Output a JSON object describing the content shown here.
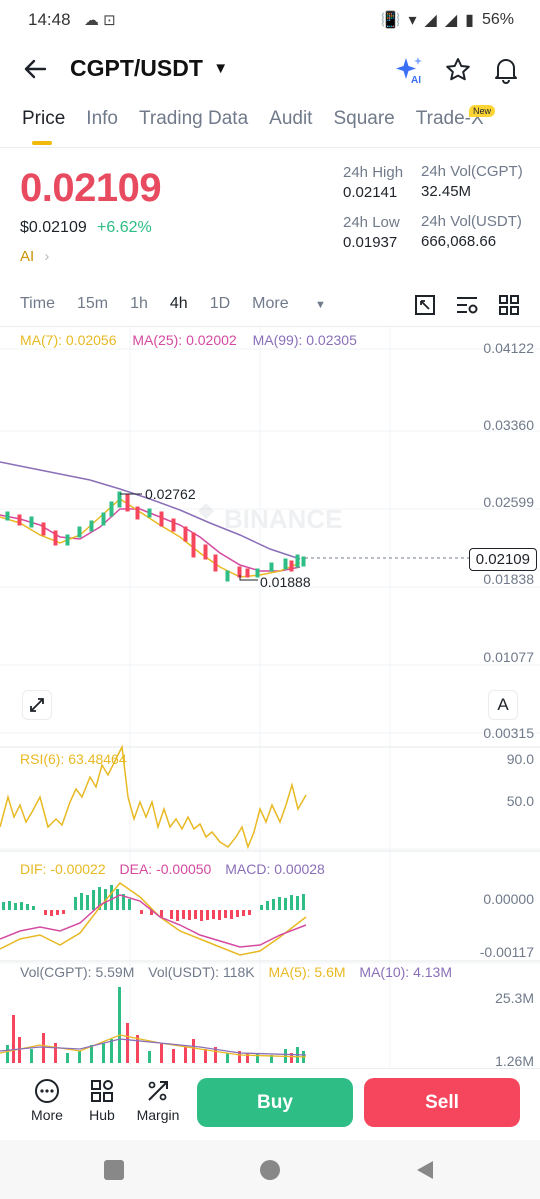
{
  "status_bar": {
    "time": "14:48",
    "battery": "56%"
  },
  "header": {
    "pair": "CGPT/USDT"
  },
  "tabs": [
    {
      "label": "Price"
    },
    {
      "label": "Info"
    },
    {
      "label": "Trading Data"
    },
    {
      "label": "Audit"
    },
    {
      "label": "Square"
    },
    {
      "label": "Trade-X"
    }
  ],
  "new_badge": "New",
  "ticker": {
    "last_price": "0.02109",
    "usd_price": "$0.02109",
    "change": "+6.62%",
    "ai_label": "AI",
    "high_label": "24h High",
    "high_value": "0.02141",
    "low_label": "24h Low",
    "low_value": "0.01937",
    "vol_base_label": "24h Vol(CGPT)",
    "vol_base_value": "32.45M",
    "vol_quote_label": "24h Vol(USDT)",
    "vol_quote_value": "666,068.66"
  },
  "intervals": [
    "Time",
    "15m",
    "1h",
    "4h",
    "1D",
    "More"
  ],
  "ma_line": {
    "ma7": "MA(7): 0.02056",
    "ma25": "MA(25): 0.02002",
    "ma99": "MA(99): 0.02305"
  },
  "price_axis": [
    "0.04122",
    "0.03360",
    "0.02599",
    "0.01838",
    "0.01077",
    "0.00315"
  ],
  "chart_marks": {
    "high": "0.02762",
    "low": "0.01888",
    "current": "0.02109",
    "watermark": "BINANCE",
    "a_button": "A"
  },
  "rsi": {
    "label": "RSI(6): 63.48464",
    "axis": [
      "90.0",
      "50.0"
    ]
  },
  "macd": {
    "dif": "DIF: -0.00022",
    "dea": "DEA: -0.00050",
    "macd": "MACD: 0.00028",
    "axis": [
      "0.00000",
      "-0.00117"
    ]
  },
  "volume": {
    "vol_base": "Vol(CGPT): 5.59M",
    "vol_quote": "Vol(USDT): 118K",
    "ma5": "MA(5): 5.6M",
    "ma10": "MA(10): 4.13M",
    "axis": [
      "25.3M",
      "1.26M"
    ]
  },
  "bottom_nav": {
    "more": "More",
    "hub": "Hub",
    "margin": "Margin",
    "buy": "Buy",
    "sell": "Sell"
  },
  "colors": {
    "up": "#2ebd85",
    "down": "#f6465d",
    "accent": "#f0b90b",
    "ma7": "#e8b923",
    "ma25": "#d44aa0",
    "ma99": "#8a6fb8"
  }
}
